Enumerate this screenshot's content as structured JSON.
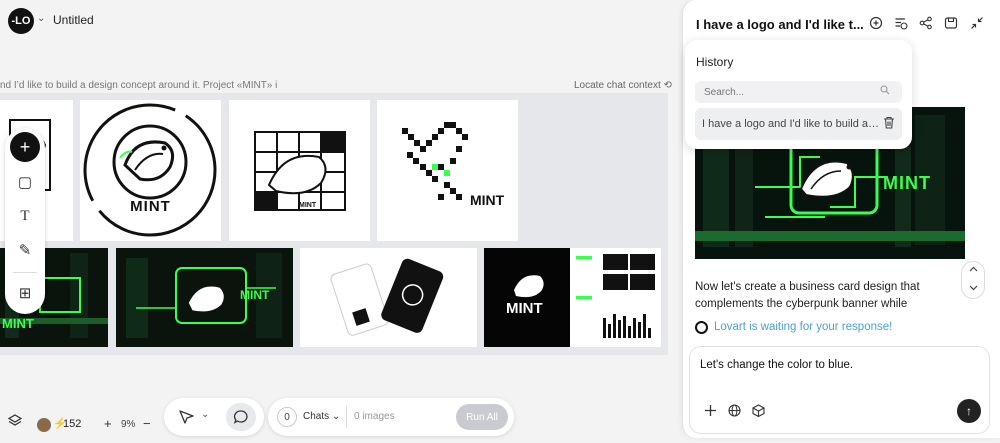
{
  "header": {
    "logo_text": "-LO",
    "caret": "⌄",
    "title": "Untitled"
  },
  "canvas": {
    "context_line": "nd I’d like to build a design concept around it. Project «MINT» i",
    "locate_link": "Locate chat context",
    "locate_icon": "⟲",
    "brand": "MINT"
  },
  "tools": {
    "add": "+",
    "frame": "▢",
    "text": "T",
    "pen": "✎",
    "template": "⊞",
    "icons": [
      "plus-icon",
      "square-icon",
      "text-icon",
      "pencil-icon",
      "layout-icon"
    ]
  },
  "bottom_bar": {
    "credits": "152",
    "bolt": "⚡",
    "zoom_plus": "+",
    "zoom": "9%",
    "zoom_minus": "−",
    "mode_caret": "⌄",
    "chat_count": "0",
    "chats_label": "Chats",
    "chats_caret": "⌄",
    "images_label": "0 images",
    "run_all": "Run All"
  },
  "panel": {
    "title": "I have a logo and I'd like t...",
    "history": {
      "title": "History",
      "search_placeholder": "Search...",
      "item": "I have a logo and I'd like to build a ..."
    },
    "message": "Now let's create a business card design that complements the cyberpunk banner while",
    "waiting": "Lovart is waiting for your response!",
    "composer_text": "Let's change the color to blue.",
    "send": "↑",
    "banner_brand": "MINT"
  },
  "colors": {
    "accent_green": "#39ff4f",
    "waiting_blue": "#4b9fd6",
    "run_all_bg": "#c9cbd1"
  }
}
